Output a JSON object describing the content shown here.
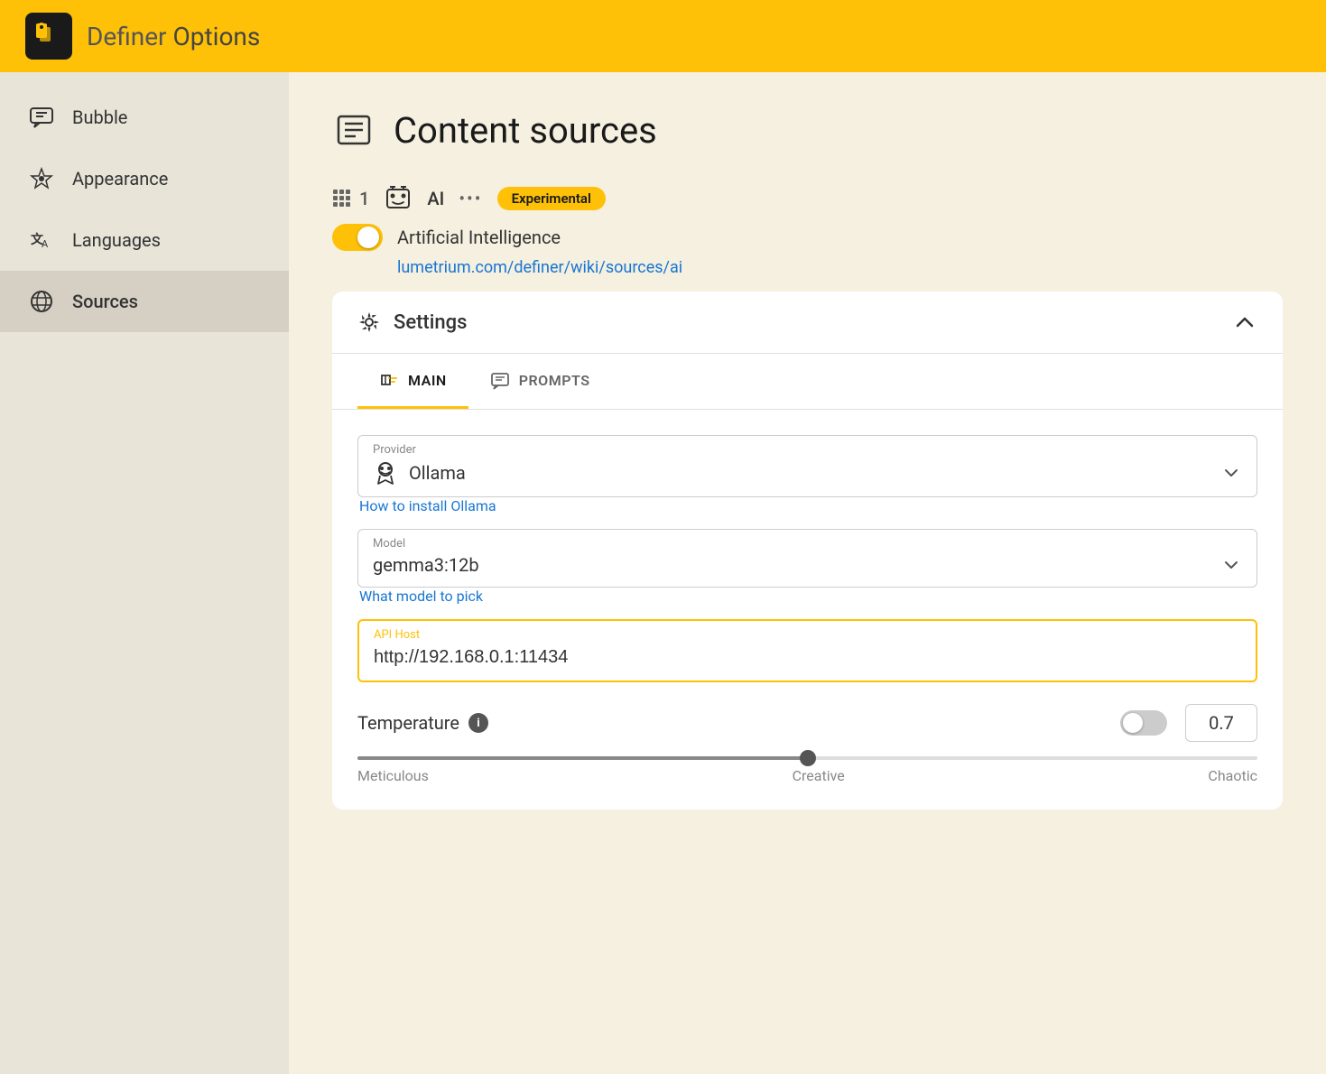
{
  "header": {
    "title": "Definer",
    "subtitle": " Options"
  },
  "sidebar": {
    "items": [
      {
        "id": "bubble",
        "label": "Bubble",
        "active": false
      },
      {
        "id": "appearance",
        "label": "Appearance",
        "active": false
      },
      {
        "id": "languages",
        "label": "Languages",
        "active": false
      },
      {
        "id": "sources",
        "label": "Sources",
        "active": true
      }
    ]
  },
  "page": {
    "title": "Content sources",
    "source_number": "1",
    "source_type": "AI",
    "source_badge": "Experimental",
    "source_name": "Artificial Intelligence",
    "source_url": "lumetrium.com/definer/wiki/sources/ai",
    "settings": {
      "title": "Settings",
      "tabs": [
        {
          "id": "main",
          "label": "MAIN",
          "active": true
        },
        {
          "id": "prompts",
          "label": "PROMPTS",
          "active": false
        }
      ],
      "provider_label": "Provider",
      "provider_value": "Ollama",
      "provider_link": "How to install Ollama",
      "model_label": "Model",
      "model_value": "gemma3:12b",
      "model_link": "What model to pick",
      "api_host_label": "API Host",
      "api_host_value": "http://192.168.0.1:11434",
      "temperature_label": "Temperature",
      "temperature_value": "0.7",
      "slider_labels": {
        "left": "Meticulous",
        "center": "Creative",
        "right": "Chaotic"
      }
    }
  }
}
